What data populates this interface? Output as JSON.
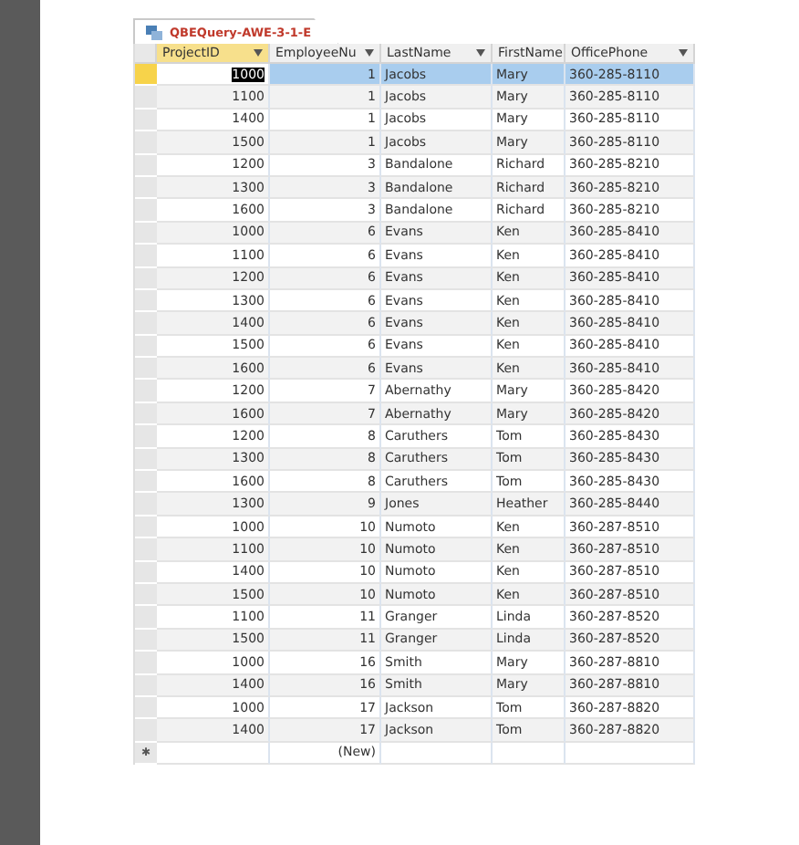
{
  "tab": {
    "title": "QBEQuery-AWE-3-1-E"
  },
  "table": {
    "columns": [
      {
        "label": "ProjectID",
        "selected": true
      },
      {
        "label": "EmployeeNu",
        "selected": false
      },
      {
        "label": "LastName",
        "selected": false
      },
      {
        "label": "FirstName",
        "selected": false
      },
      {
        "label": "OfficePhone",
        "selected": false
      }
    ],
    "rows": [
      {
        "selected": true,
        "cells": [
          "1000",
          "1",
          "Jacobs",
          "Mary",
          "360-285-8110"
        ]
      },
      {
        "selected": false,
        "cells": [
          "1100",
          "1",
          "Jacobs",
          "Mary",
          "360-285-8110"
        ]
      },
      {
        "selected": false,
        "cells": [
          "1400",
          "1",
          "Jacobs",
          "Mary",
          "360-285-8110"
        ]
      },
      {
        "selected": false,
        "cells": [
          "1500",
          "1",
          "Jacobs",
          "Mary",
          "360-285-8110"
        ]
      },
      {
        "selected": false,
        "cells": [
          "1200",
          "3",
          "Bandalone",
          "Richard",
          "360-285-8210"
        ]
      },
      {
        "selected": false,
        "cells": [
          "1300",
          "3",
          "Bandalone",
          "Richard",
          "360-285-8210"
        ]
      },
      {
        "selected": false,
        "cells": [
          "1600",
          "3",
          "Bandalone",
          "Richard",
          "360-285-8210"
        ]
      },
      {
        "selected": false,
        "cells": [
          "1000",
          "6",
          "Evans",
          "Ken",
          "360-285-8410"
        ]
      },
      {
        "selected": false,
        "cells": [
          "1100",
          "6",
          "Evans",
          "Ken",
          "360-285-8410"
        ]
      },
      {
        "selected": false,
        "cells": [
          "1200",
          "6",
          "Evans",
          "Ken",
          "360-285-8410"
        ]
      },
      {
        "selected": false,
        "cells": [
          "1300",
          "6",
          "Evans",
          "Ken",
          "360-285-8410"
        ]
      },
      {
        "selected": false,
        "cells": [
          "1400",
          "6",
          "Evans",
          "Ken",
          "360-285-8410"
        ]
      },
      {
        "selected": false,
        "cells": [
          "1500",
          "6",
          "Evans",
          "Ken",
          "360-285-8410"
        ]
      },
      {
        "selected": false,
        "cells": [
          "1600",
          "6",
          "Evans",
          "Ken",
          "360-285-8410"
        ]
      },
      {
        "selected": false,
        "cells": [
          "1200",
          "7",
          "Abernathy",
          "Mary",
          "360-285-8420"
        ]
      },
      {
        "selected": false,
        "cells": [
          "1600",
          "7",
          "Abernathy",
          "Mary",
          "360-285-8420"
        ]
      },
      {
        "selected": false,
        "cells": [
          "1200",
          "8",
          "Caruthers",
          "Tom",
          "360-285-8430"
        ]
      },
      {
        "selected": false,
        "cells": [
          "1300",
          "8",
          "Caruthers",
          "Tom",
          "360-285-8430"
        ]
      },
      {
        "selected": false,
        "cells": [
          "1600",
          "8",
          "Caruthers",
          "Tom",
          "360-285-8430"
        ]
      },
      {
        "selected": false,
        "cells": [
          "1300",
          "9",
          "Jones",
          "Heather",
          "360-285-8440"
        ]
      },
      {
        "selected": false,
        "cells": [
          "1000",
          "10",
          "Numoto",
          "Ken",
          "360-287-8510"
        ]
      },
      {
        "selected": false,
        "cells": [
          "1100",
          "10",
          "Numoto",
          "Ken",
          "360-287-8510"
        ]
      },
      {
        "selected": false,
        "cells": [
          "1400",
          "10",
          "Numoto",
          "Ken",
          "360-287-8510"
        ]
      },
      {
        "selected": false,
        "cells": [
          "1500",
          "10",
          "Numoto",
          "Ken",
          "360-287-8510"
        ]
      },
      {
        "selected": false,
        "cells": [
          "1100",
          "11",
          "Granger",
          "Linda",
          "360-287-8520"
        ]
      },
      {
        "selected": false,
        "cells": [
          "1500",
          "11",
          "Granger",
          "Linda",
          "360-287-8520"
        ]
      },
      {
        "selected": false,
        "cells": [
          "1000",
          "16",
          "Smith",
          "Mary",
          "360-287-8810"
        ]
      },
      {
        "selected": false,
        "cells": [
          "1400",
          "16",
          "Smith",
          "Mary",
          "360-287-8810"
        ]
      },
      {
        "selected": false,
        "cells": [
          "1000",
          "17",
          "Jackson",
          "Tom",
          "360-287-8820"
        ]
      },
      {
        "selected": false,
        "cells": [
          "1400",
          "17",
          "Jackson",
          "Tom",
          "360-287-8820"
        ]
      }
    ],
    "new_row": {
      "marker": "✱",
      "label": "(New)"
    }
  }
}
